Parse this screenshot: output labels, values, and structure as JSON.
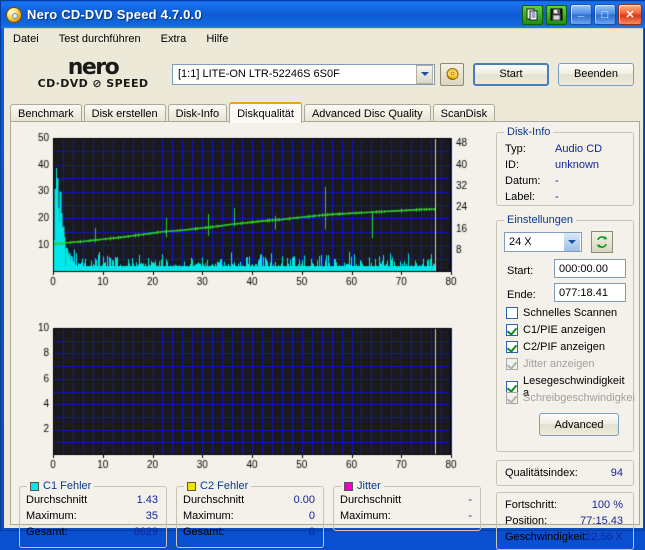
{
  "window": {
    "title": "Nero CD-DVD Speed 4.7.0.0",
    "icon": "cd-disc-icon",
    "toolbar_buttons": [
      {
        "name": "copy-to-clipboard-button",
        "icon": "clipboard-copy-icon"
      },
      {
        "name": "save-button",
        "icon": "floppy-disk-icon"
      }
    ],
    "minimize": "_",
    "maximize": "□",
    "close": "✕"
  },
  "menu": {
    "items": [
      {
        "label": "Datei"
      },
      {
        "label": "Test durchführen"
      },
      {
        "label": "Extra"
      },
      {
        "label": "Hilfe"
      }
    ]
  },
  "logo": {
    "line1": "nero",
    "line2": "CD·DVD ⊘ SPEED"
  },
  "header": {
    "drive": "[1:1]  LITE-ON LTR-52246S 6S0F",
    "refresh_icon": "refresh-arrows-icon",
    "start_label": "Start",
    "quit_label": "Beenden"
  },
  "tabs": [
    {
      "label": "Benchmark",
      "active": false
    },
    {
      "label": "Disk erstellen",
      "active": false
    },
    {
      "label": "Disk-Info",
      "active": false
    },
    {
      "label": "Diskqualität",
      "active": true
    },
    {
      "label": "Advanced Disc Quality",
      "active": false
    },
    {
      "label": "ScanDisk",
      "active": false
    }
  ],
  "disk_info": {
    "caption": "Disk-Info",
    "rows": [
      {
        "label": "Typ:",
        "value": "Audio CD"
      },
      {
        "label": "ID:",
        "value": "unknown"
      },
      {
        "label": "Datum:",
        "value": "-"
      },
      {
        "label": "Label:",
        "value": "-"
      }
    ]
  },
  "settings": {
    "caption": "Einstellungen",
    "speed": "24 X",
    "refresh_icon": "refresh-arrows-icon",
    "start_label": "Start:",
    "start_value": "000:00.00",
    "end_label": "Ende:",
    "end_value": "077:18.41",
    "checkboxes": [
      {
        "label": "Schnelles Scannen",
        "checked": false,
        "disabled": false
      },
      {
        "label": "C1/PIE anzeigen",
        "checked": true,
        "disabled": false
      },
      {
        "label": "C2/PIF anzeigen",
        "checked": true,
        "disabled": false
      },
      {
        "label": "Jitter anzeigen",
        "checked": true,
        "disabled": true
      },
      {
        "label": "Lesegeschwindigkeit a",
        "checked": true,
        "disabled": false
      },
      {
        "label": "Schreibgeschwindigkei",
        "checked": true,
        "disabled": true
      }
    ],
    "advanced_label": "Advanced"
  },
  "quality": {
    "label": "Qualitätsindex:",
    "value": "94"
  },
  "progress": {
    "rows": [
      {
        "label": "Fortschritt:",
        "value": "100 %"
      },
      {
        "label": "Position:",
        "value": "77:15.43"
      },
      {
        "label": "Geschwindigkeit:",
        "value": "22.56 X"
      }
    ]
  },
  "stats": [
    {
      "caption": "C1 Fehler",
      "color": "#00e8e8",
      "rows": [
        {
          "label": "Durchschnitt",
          "value": "1.43"
        },
        {
          "label": "Maximum:",
          "value": "35"
        },
        {
          "label": "Gesamt:",
          "value": "6629"
        }
      ]
    },
    {
      "caption": "C2 Fehler",
      "color": "#f2e400",
      "rows": [
        {
          "label": "Durchschnitt",
          "value": "0.00"
        },
        {
          "label": "Maximum:",
          "value": "0"
        },
        {
          "label": "Gesamt:",
          "value": "0"
        }
      ]
    },
    {
      "caption": "Jitter",
      "color": "#f000c8",
      "rows": [
        {
          "label": "Durchschnitt",
          "value": "-"
        },
        {
          "label": "Maximum:",
          "value": "-"
        }
      ]
    }
  ],
  "chart_data": [
    {
      "type": "area",
      "name": "c1-error-and-speed-graph",
      "title": "",
      "xlabel": "",
      "ylabel": "",
      "xlim": [
        0,
        80
      ],
      "xticks": [
        0,
        10,
        20,
        30,
        40,
        50,
        60,
        70,
        80
      ],
      "ylim_left": [
        0,
        50
      ],
      "yticks_left": [
        10,
        20,
        30,
        40,
        50
      ],
      "ylim_right": [
        0,
        50
      ],
      "yticks_right": [
        8,
        16,
        24,
        32,
        40,
        48
      ],
      "grid": true,
      "plot_bg": "#1a1a1a",
      "grid_color": "#1414c8",
      "scan_end_marker": 76.8,
      "series": [
        {
          "name": "C1 Fehler",
          "kind": "spikes",
          "color": "#00e8e8",
          "axis": "left",
          "x": [
            0.2,
            0.5,
            0.8,
            1.1,
            1.4,
            1.7,
            2.0,
            2.3,
            2.6,
            2.9,
            3.3,
            3.7,
            4.1,
            4.6,
            5.1,
            5.7,
            6.3,
            7.0,
            7.8,
            8.6,
            9.5,
            10.4,
            11.3,
            12.2,
            13.1,
            14.0,
            15.0,
            16.0,
            17.0,
            18.0,
            19.0,
            20.0,
            21.0,
            22.0,
            23.0,
            24.0,
            25.0,
            26.0,
            27.0,
            28.0,
            29.0,
            30.0,
            31.0,
            32.0,
            33.0,
            34.0,
            35.0,
            36.0,
            37.0,
            38.0,
            39.0,
            40.0,
            41.0,
            42.0,
            43.0,
            44.0,
            45.0,
            46.0,
            47.0,
            48.0,
            49.0,
            50.0,
            51.0,
            52.0,
            53.0,
            54.0,
            55.0,
            56.0,
            57.0,
            58.0,
            59.0,
            60.0,
            61.0,
            62.0,
            63.0,
            64.0,
            65.0,
            66.0,
            67.0,
            68.0,
            69.0,
            70.0,
            71.0,
            72.0,
            73.0,
            74.0,
            75.0,
            76.0,
            76.8
          ],
          "y": [
            12,
            31,
            35,
            24,
            30,
            22,
            17,
            13,
            9,
            8,
            7,
            6,
            7,
            5,
            8,
            6,
            5,
            4,
            4,
            4,
            4,
            3,
            11,
            4,
            3,
            3,
            4,
            3,
            4,
            3,
            3,
            4,
            3,
            3,
            3,
            4,
            3,
            3,
            4,
            3,
            3,
            3,
            4,
            3,
            3,
            3,
            3,
            4,
            3,
            3,
            3,
            4,
            3,
            3,
            3,
            4,
            3,
            3,
            4,
            3,
            3,
            4,
            3,
            3,
            3,
            4,
            3,
            8,
            4,
            3,
            3,
            4,
            3,
            3,
            4,
            3,
            3,
            4,
            3,
            3,
            4,
            3,
            3,
            4,
            3,
            3,
            4,
            3,
            3
          ],
          "baseline_avg": 1.43
        },
        {
          "name": "Lesegeschwindigkeit",
          "kind": "line",
          "color": "#2ecc2e",
          "axis": "right",
          "x": [
            0,
            2,
            4,
            6,
            8,
            10,
            12,
            14,
            16,
            18,
            20,
            22,
            24,
            26,
            28,
            30,
            32,
            34,
            36,
            38,
            40,
            42,
            44,
            46,
            48,
            50,
            52,
            54,
            56,
            58,
            60,
            62,
            64,
            66,
            68,
            70,
            72,
            74,
            76,
            76.8
          ],
          "y": [
            10.4,
            10.7,
            11.1,
            11.4,
            11.8,
            12.2,
            12.6,
            13.0,
            13.5,
            14.0,
            14.5,
            15.0,
            15.3,
            15.6,
            16.0,
            16.4,
            16.8,
            17.3,
            17.8,
            18.2,
            18.6,
            19.0,
            19.3,
            19.6,
            20.0,
            20.4,
            20.8,
            21.2,
            21.5,
            21.7,
            21.9,
            22.1,
            22.3,
            22.5,
            22.7,
            22.9,
            23.1,
            23.3,
            23.4,
            23.4
          ],
          "spikes": [
            {
              "x": 8.5,
              "low": 11.0,
              "high": 16.5
            },
            {
              "x": 22.8,
              "low": 13.0,
              "high": 20.2
            },
            {
              "x": 31.2,
              "low": 13.4,
              "high": 21.6
            },
            {
              "x": 36.4,
              "low": 17.0,
              "high": 23.8
            },
            {
              "x": 44.6,
              "low": 15.8,
              "high": 21.0
            },
            {
              "x": 54.6,
              "low": 15.8,
              "high": 31.8
            },
            {
              "x": 64.2,
              "low": 12.6,
              "high": 22.6
            }
          ]
        }
      ]
    },
    {
      "type": "area",
      "name": "c2-error-graph",
      "title": "",
      "xlabel": "",
      "ylabel": "",
      "xlim": [
        0,
        80
      ],
      "xticks": [
        0,
        10,
        20,
        30,
        40,
        50,
        60,
        70,
        80
      ],
      "ylim": [
        0,
        10
      ],
      "yticks": [
        2,
        4,
        6,
        8,
        10
      ],
      "grid": true,
      "plot_bg": "#1a1a1a",
      "grid_color": "#1414c8",
      "scan_end_marker": 76.8,
      "series": [
        {
          "name": "C2 Fehler",
          "kind": "spikes",
          "color": "#f2e400",
          "x": [],
          "y": []
        }
      ]
    }
  ]
}
